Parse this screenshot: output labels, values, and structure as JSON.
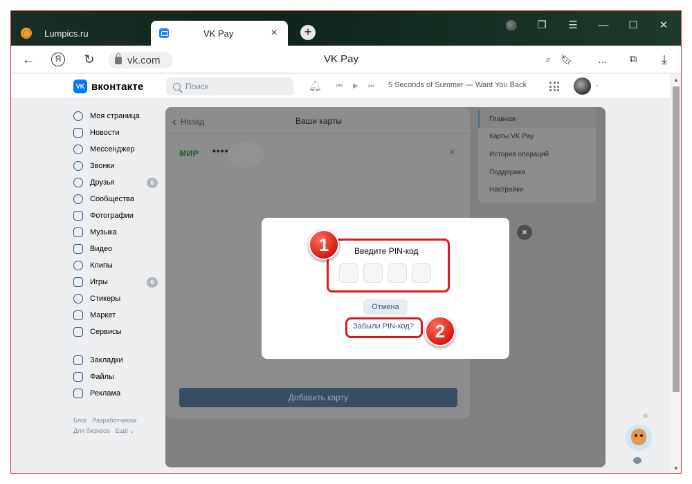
{
  "browser": {
    "tabs": [
      {
        "title": "Lumpics.ru",
        "active": false,
        "favicon": "lumpics-favicon"
      },
      {
        "title": "VK Pay",
        "active": true,
        "favicon": "vk-favicon"
      }
    ],
    "new_tab_symbol": "+",
    "close_symbol": "×",
    "window_controls": [
      "profile-avatar",
      "collections-icon",
      "menu-icon",
      "minimize-icon",
      "maximize-icon",
      "close-icon"
    ],
    "url": "vk.com",
    "page_title": "VK Pay",
    "address_icons": [
      "back-arrow-icon",
      "yandex-icon",
      "reload-icon",
      "lock-icon",
      "protect-icon",
      "bookmark-icon",
      "more-icon",
      "collections-icon",
      "download-icon"
    ]
  },
  "vk_header": {
    "logo_mark": "VK",
    "logo_text": "вконтакте",
    "search_placeholder": "Поиск",
    "now_playing": "5 Seconds of Summer — Want You Back"
  },
  "sidebar": {
    "items": [
      {
        "label": "Моя страница",
        "icon": "user-circle-icon",
        "badge": ""
      },
      {
        "label": "Новости",
        "icon": "news-icon",
        "badge": ""
      },
      {
        "label": "Мессенджер",
        "icon": "message-icon",
        "badge": ""
      },
      {
        "label": "Звонки",
        "icon": "phone-icon",
        "badge": ""
      },
      {
        "label": "Друзья",
        "icon": "friends-icon",
        "badge": "6"
      },
      {
        "label": "Сообщества",
        "icon": "communities-icon",
        "badge": ""
      },
      {
        "label": "Фотографии",
        "icon": "photo-icon",
        "badge": ""
      },
      {
        "label": "Музыка",
        "icon": "music-icon",
        "badge": ""
      },
      {
        "label": "Видео",
        "icon": "video-icon",
        "badge": ""
      },
      {
        "label": "Клипы",
        "icon": "clips-icon",
        "badge": ""
      },
      {
        "label": "Игры",
        "icon": "games-icon",
        "badge": "6"
      },
      {
        "label": "Стикеры",
        "icon": "stickers-icon",
        "badge": ""
      },
      {
        "label": "Маркет",
        "icon": "market-icon",
        "badge": ""
      },
      {
        "label": "Сервисы",
        "icon": "services-icon",
        "badge": ""
      }
    ],
    "items2": [
      {
        "label": "Закладки",
        "icon": "bookmark-icon"
      },
      {
        "label": "Файлы",
        "icon": "file-icon"
      },
      {
        "label": "Реклама",
        "icon": "megaphone-icon"
      }
    ],
    "footer": {
      "blog": "Блог",
      "developers": "Разработчикам",
      "business": "Для бизнеса",
      "more": "Ещё ⌄"
    }
  },
  "cards_panel": {
    "back_label": "Назад",
    "title": "Ваши карты",
    "card_brand": "МИР",
    "card_mask": "••••",
    "add_card_label": "Добавить карту"
  },
  "right_nav": {
    "items": [
      "Главная",
      "Карты VK Pay",
      "История операций",
      "Поддержка",
      "Настройки"
    ]
  },
  "pin_modal": {
    "title": "Введите PIN-код",
    "cancel_label": "Отмена",
    "forgot_label": "Забыли PIN-код?",
    "digits": [
      "",
      "",
      "",
      ""
    ]
  },
  "annotations": {
    "marker1": "1",
    "marker2": "2",
    "highlight_color": "#e0161c"
  },
  "colors": {
    "vk_blue": "#0077ff",
    "link": "#2a5885"
  }
}
